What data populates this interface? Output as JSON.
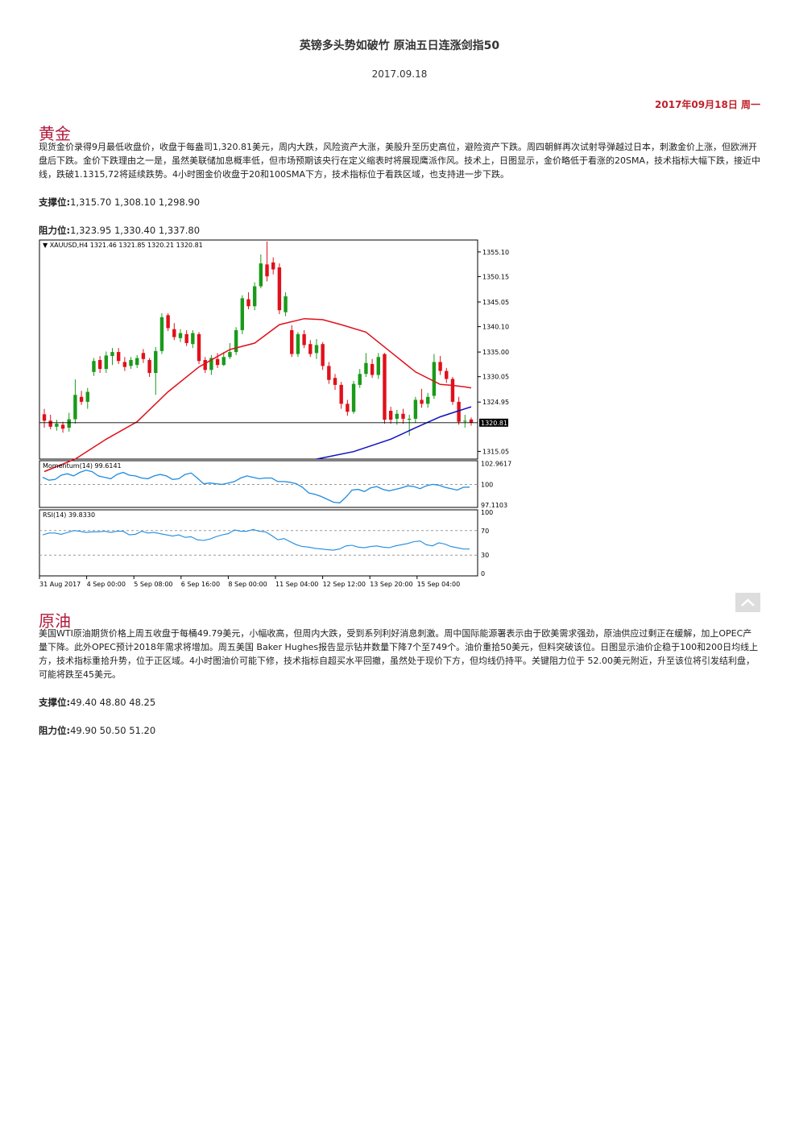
{
  "header": {
    "title": "英镑多头势如破竹 原油五日连涨剑指50",
    "date": "2017.09.18",
    "weekday_date": "2017年09月18日 周一"
  },
  "gold": {
    "heading": "黄金",
    "paragraph": "现货金价录得9月最低收盘价，收盘于每盎司1,320.81美元，周内大跌，风险资产大涨，美股升至历史高位，避险资产下跌。周四朝鲜再次试射导弹越过日本，刺激金价上涨，但欧洲开盘后下跌。金价下跌理由之一是，虽然美联储加息概率低，但市场预期该央行在定义缩表时将展现鹰派作风。技术上，日图显示，金价略低于看涨的20SMA，技术指标大幅下跌，接近中线，跌破1.1315,72将延续跌势。4小时图金价收盘于20和100SMA下方，技术指标位于看跌区域，也支持进一步下跌。",
    "support_label": "支撑位:",
    "support_values": "1,315.70 1,308.10 1,298.90",
    "resistance_label": "阻力位:",
    "resistance_values": "1,323.95 1,330.40 1,337.80"
  },
  "oil": {
    "heading": "原油",
    "paragraph": "美国WTI原油期货价格上周五收盘于每桶49.79美元，小幅收高，但周内大跌，受到系列利好消息刺激。周中国际能源署表示由于欧美需求强劲，原油供应过剩正在缓解，加上OPEC产量下降。此外OPEC预计2018年需求将增加。周五美国 Baker Hughes报告显示钻井数量下降7个至749个。油价重拾50美元，但料突破该位。日图显示油价企稳于100和200日均线上方，技术指标重拾升势，位于正区域。4小时图油价可能下修，技术指标自超买水平回撤，虽然处于现价下方，但均线仍持平。关键阻力位于 52.00美元附近，升至该位将引发结利盘，可能将跌至45美元。",
    "support_label": "支撑位:",
    "support_values": "49.40 48.80 48.25",
    "resistance_label": "阻力位:",
    "resistance_values": "49.90 50.50 51.20"
  },
  "colors": {
    "heading": "#b11a3b",
    "bull": "#1a9a1a",
    "bear": "#e0101a",
    "sma20": "#e0101a",
    "sma100": "#1010c0",
    "indicator": "#1e8ce0"
  },
  "chart_data": {
    "type": "candlestick",
    "header_label": "XAUUSD,H4  1321.46 1321.85 1320.21 1320.81",
    "current_price_label": "1320.81",
    "price_axis": {
      "ticks": [
        "1355.10",
        "1350.15",
        "1345.05",
        "1340.10",
        "1335.00",
        "1330.05",
        "1324.95",
        "1315.05"
      ],
      "range": [
        1313.5,
        1357.5
      ]
    },
    "x_tick_labels": [
      "31 Aug 2017",
      "4 Sep 00:00",
      "5 Sep 08:00",
      "6 Sep 16:00",
      "8 Sep 00:00",
      "11 Sep 04:00",
      "12 Sep 12:00",
      "13 Sep 20:00",
      "15 Sep 04:00"
    ],
    "candles": [
      [
        1322.5,
        1321.2,
        1323.6,
        1319.8
      ],
      [
        1321.2,
        1320.0,
        1322.4,
        1319.5
      ],
      [
        1320.0,
        1320.6,
        1321.4,
        1319.2
      ],
      [
        1320.4,
        1319.6,
        1321.0,
        1318.8
      ],
      [
        1319.8,
        1321.5,
        1322.8,
        1319.0
      ],
      [
        1321.5,
        1326.4,
        1329.5,
        1320.6
      ],
      [
        1326.0,
        1325.0,
        1327.2,
        1324.4
      ],
      [
        1325.0,
        1327.0,
        1327.8,
        1323.6
      ],
      [
        1331.0,
        1333.2,
        1333.8,
        1330.2
      ],
      [
        1333.4,
        1331.6,
        1334.2,
        1330.8
      ],
      [
        1331.6,
        1334.3,
        1335.1,
        1330.8
      ],
      [
        1334.2,
        1335.0,
        1335.8,
        1332.4
      ],
      [
        1335.0,
        1333.2,
        1335.8,
        1332.6
      ],
      [
        1333.0,
        1332.0,
        1334.0,
        1331.2
      ],
      [
        1332.2,
        1333.4,
        1334.0,
        1331.6
      ],
      [
        1332.4,
        1333.8,
        1334.4,
        1331.8
      ],
      [
        1334.8,
        1333.6,
        1335.6,
        1332.8
      ],
      [
        1333.4,
        1330.8,
        1333.8,
        1330.0
      ],
      [
        1330.8,
        1335.2,
        1336.0,
        1326.4
      ],
      [
        1335.2,
        1342.0,
        1342.8,
        1334.6
      ],
      [
        1342.4,
        1339.8,
        1342.8,
        1339.2
      ],
      [
        1339.6,
        1338.0,
        1340.8,
        1337.4
      ],
      [
        1337.8,
        1338.8,
        1339.6,
        1337.0
      ],
      [
        1338.6,
        1336.8,
        1339.4,
        1336.2
      ],
      [
        1336.6,
        1338.8,
        1339.4,
        1335.8
      ],
      [
        1338.6,
        1333.2,
        1339.0,
        1332.6
      ],
      [
        1333.4,
        1331.4,
        1334.0,
        1330.8
      ],
      [
        1331.4,
        1333.8,
        1334.4,
        1330.4
      ],
      [
        1333.6,
        1332.4,
        1334.8,
        1331.8
      ],
      [
        1332.4,
        1334.0,
        1335.0,
        1332.2
      ],
      [
        1334.0,
        1335.0,
        1336.8,
        1333.6
      ],
      [
        1335.0,
        1339.4,
        1340.0,
        1334.4
      ],
      [
        1339.4,
        1345.8,
        1346.4,
        1338.6
      ],
      [
        1345.6,
        1344.2,
        1347.0,
        1343.6
      ],
      [
        1344.2,
        1348.2,
        1349.0,
        1343.4
      ],
      [
        1348.2,
        1352.8,
        1354.6,
        1347.8
      ],
      [
        1352.6,
        1350.2,
        1357.2,
        1349.2
      ],
      [
        1353.0,
        1351.6,
        1354.0,
        1350.6
      ],
      [
        1352.0,
        1343.4,
        1352.8,
        1342.6
      ],
      [
        1343.0,
        1346.2,
        1347.0,
        1342.2
      ],
      [
        1339.4,
        1334.6,
        1340.4,
        1334.0
      ],
      [
        1334.6,
        1338.6,
        1339.0,
        1334.0
      ],
      [
        1338.6,
        1336.4,
        1339.4,
        1335.8
      ],
      [
        1336.6,
        1334.6,
        1337.4,
        1334.0
      ],
      [
        1334.8,
        1336.4,
        1337.6,
        1333.6
      ],
      [
        1336.6,
        1332.2,
        1337.0,
        1331.4
      ],
      [
        1332.2,
        1329.4,
        1333.0,
        1328.6
      ],
      [
        1329.8,
        1328.4,
        1330.6,
        1327.4
      ],
      [
        1328.4,
        1324.6,
        1329.0,
        1323.6
      ],
      [
        1324.6,
        1323.0,
        1325.4,
        1322.2
      ],
      [
        1323.0,
        1328.6,
        1329.2,
        1322.6
      ],
      [
        1328.4,
        1330.6,
        1331.6,
        1327.8
      ],
      [
        1330.6,
        1332.8,
        1334.8,
        1330.0
      ],
      [
        1332.6,
        1330.4,
        1333.6,
        1329.8
      ],
      [
        1330.4,
        1334.0,
        1334.8,
        1329.6
      ],
      [
        1334.6,
        1321.4,
        1334.8,
        1320.6
      ],
      [
        1323.2,
        1321.4,
        1324.0,
        1320.6
      ],
      [
        1321.6,
        1322.6,
        1323.4,
        1320.4
      ],
      [
        1322.6,
        1321.6,
        1323.6,
        1320.6
      ],
      [
        1321.4,
        1321.6,
        1322.4,
        1318.2
      ],
      [
        1321.6,
        1325.4,
        1326.0,
        1320.8
      ],
      [
        1325.4,
        1324.6,
        1327.6,
        1323.8
      ],
      [
        1324.6,
        1326.0,
        1326.8,
        1323.8
      ],
      [
        1326.2,
        1333.0,
        1334.6,
        1325.6
      ],
      [
        1333.0,
        1331.2,
        1334.2,
        1330.4
      ],
      [
        1331.2,
        1329.6,
        1331.8,
        1328.8
      ],
      [
        1329.6,
        1325.0,
        1330.0,
        1324.4
      ],
      [
        1325.0,
        1321.0,
        1326.0,
        1320.4
      ],
      [
        1321.2,
        1321.2,
        1322.4,
        1319.8
      ],
      [
        1321.46,
        1320.81,
        1321.85,
        1320.21
      ]
    ],
    "sma20": [
      [
        0,
        1311.0
      ],
      [
        5,
        1313.5
      ],
      [
        10,
        1317.5
      ],
      [
        15,
        1321.0
      ],
      [
        20,
        1327.0
      ],
      [
        25,
        1332.0
      ],
      [
        30,
        1335.5
      ],
      [
        34,
        1336.8
      ],
      [
        38,
        1340.5
      ],
      [
        42,
        1341.7
      ],
      [
        45,
        1341.5
      ],
      [
        48,
        1340.5
      ],
      [
        52,
        1339.0
      ],
      [
        56,
        1335.0
      ],
      [
        60,
        1331.0
      ],
      [
        64,
        1328.5
      ],
      [
        66,
        1328.3
      ],
      [
        68,
        1328.0
      ],
      [
        69,
        1327.8
      ]
    ],
    "sma100": [
      [
        44,
        1313.5
      ],
      [
        50,
        1315.0
      ],
      [
        56,
        1317.5
      ],
      [
        60,
        1319.8
      ],
      [
        64,
        1322.0
      ],
      [
        67,
        1323.2
      ],
      [
        69,
        1324.0
      ]
    ],
    "momentum": {
      "label": "Momentum(14) 99.6141",
      "ticks": [
        "102.9617",
        "100",
        "97.1103"
      ],
      "range": [
        97.1,
        103.0
      ],
      "level": 100,
      "values": [
        101.0,
        100.6,
        100.7,
        101.3,
        101.5,
        101.2,
        101.7,
        102.0,
        101.8,
        101.2,
        101.0,
        100.8,
        101.4,
        101.7,
        101.3,
        101.2,
        100.9,
        100.8,
        101.2,
        101.4,
        101.2,
        100.7,
        100.8,
        101.4,
        101.6,
        100.9,
        100.1,
        100.2,
        100.1,
        100.0,
        100.2,
        100.4,
        100.9,
        101.2,
        101.0,
        100.8,
        100.9,
        100.9,
        100.4,
        100.4,
        100.3,
        100.1,
        99.6,
        98.8,
        98.6,
        98.3,
        97.9,
        97.5,
        97.4,
        98.2,
        99.2,
        99.3,
        99.0,
        99.5,
        99.7,
        99.3,
        99.1,
        99.3,
        99.5,
        99.8,
        99.7,
        99.4,
        99.8,
        100.0,
        99.9,
        99.6,
        99.4,
        99.2,
        99.6,
        99.6141
      ]
    },
    "rsi": {
      "label": "RSI(14) 39.8330",
      "ticks": [
        "100",
        "70",
        "30",
        "0"
      ],
      "range": [
        0,
        100
      ],
      "levels": [
        70,
        30
      ],
      "values": [
        63,
        66,
        66,
        64,
        67,
        70,
        69,
        67,
        68,
        68,
        69,
        67,
        69,
        69,
        63,
        64,
        69,
        66,
        67,
        65,
        63,
        61,
        63,
        59,
        60,
        55,
        54,
        56,
        60,
        63,
        65,
        71,
        69,
        69,
        72,
        69,
        68,
        62,
        55,
        57,
        52,
        47,
        44,
        43,
        41,
        40,
        39,
        38,
        40,
        45,
        46,
        43,
        42,
        44,
        45,
        43,
        42,
        45,
        47,
        49,
        52,
        53,
        47,
        45,
        50,
        48,
        44,
        42,
        40,
        39.833
      ]
    }
  }
}
